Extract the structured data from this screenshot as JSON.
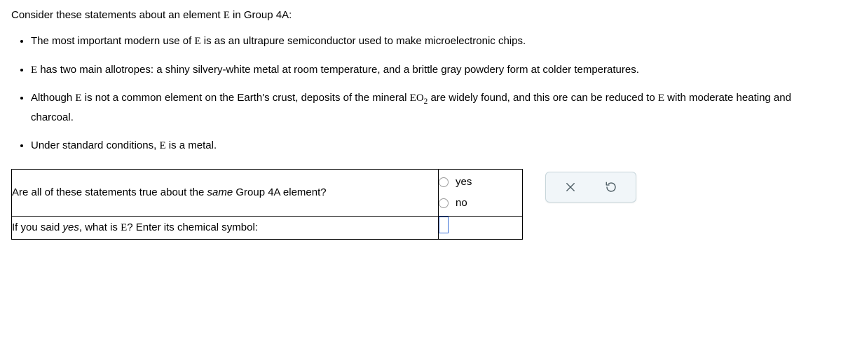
{
  "intro": "Consider these statements about an element E in Group 4A:",
  "statements": {
    "s1_a": "The most important modern use of ",
    "s1_b": " is as an ultrapure semiconductor used to make microelectronic chips.",
    "s2_a": "",
    "s2_b": " has two main allotropes: a shiny silvery-white metal at room temperature, and a brittle gray powdery form at colder temperatures.",
    "s3_a": "Although ",
    "s3_b": " is not a common element on the Earth's crust, deposits of the mineral ",
    "s3_c": " are widely found, and this ore can be reduced to ",
    "s3_d": " with moderate heating and charcoal.",
    "s4_a": "Under standard conditions, ",
    "s4_b": " is a metal."
  },
  "symbols": {
    "E": "E",
    "EO2_base": "EO",
    "EO2_sub": "2"
  },
  "question1_a": "Are all of these statements true about the ",
  "question1_same": "same",
  "question1_b": " Group 4A element?",
  "options": {
    "yes": "yes",
    "no": "no"
  },
  "question2_a": "If you said ",
  "question2_yes": "yes",
  "question2_b": ", what is ",
  "question2_c": "? Enter its chemical symbol:"
}
